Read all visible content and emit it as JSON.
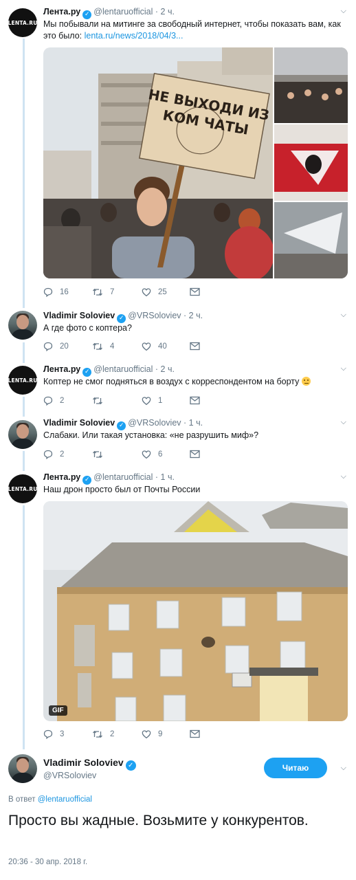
{
  "tweets": [
    {
      "author": "Лента.ру",
      "handle": "@lentaruofficial",
      "time": "2 ч.",
      "avatar_label": "LENTA.RU",
      "text": "Мы побывали на митинге за свободный интернет, чтобы показать вам, как это было: ",
      "link": "lenta.ru/news/2018/04/3...",
      "sign_text": [
        "НЕ ВЫХОДИ ИЗ",
        "КОМ   ЧАТЫ"
      ],
      "replies": "16",
      "retweets": "7",
      "likes": "25"
    },
    {
      "author": "Vladimir Soloviev",
      "handle": "@VRSoloviev",
      "time": "2 ч.",
      "text": "А где фото с коптера?",
      "replies": "20",
      "retweets": "4",
      "likes": "40"
    },
    {
      "author": "Лента.ру",
      "handle": "@lentaruofficial",
      "time": "2 ч.",
      "avatar_label": "LENTA.RU",
      "text": "Коптер не смог подняться в воздух с корреспондентом на борту",
      "replies": "2",
      "retweets": "",
      "likes": "1"
    },
    {
      "author": "Vladimir Soloviev",
      "handle": "@VRSoloviev",
      "time": "1 ч.",
      "text": "Слабаки. Или такая установка:  «не разрушить миф»?",
      "replies": "2",
      "retweets": "",
      "likes": "6"
    },
    {
      "author": "Лента.ру",
      "handle": "@lentaruofficial",
      "time": "1 ч.",
      "avatar_label": "LENTA.RU",
      "text": "Наш дрон просто был от Почты России",
      "media_badge": "GIF",
      "replies": "3",
      "retweets": "2",
      "likes": "9"
    }
  ],
  "main_tweet": {
    "author": "Vladimir Soloviev",
    "handle": "@VRSoloviev",
    "follow_label": "Читаю",
    "reply_prefix": "В ответ ",
    "reply_handle": "@lentaruofficial",
    "text": "Просто вы жадные. Возьмите у конкурентов.",
    "timestamp": "20:36 - 30 апр. 2018 г."
  },
  "colors": {
    "accent": "#1da1f2",
    "link": "#1b95e0",
    "muted": "#657786",
    "thread_line": "#cfe3f2"
  },
  "icons": [
    "verified-icon",
    "chevron-down-icon",
    "reply-icon",
    "retweet-icon",
    "like-icon",
    "message-icon"
  ]
}
